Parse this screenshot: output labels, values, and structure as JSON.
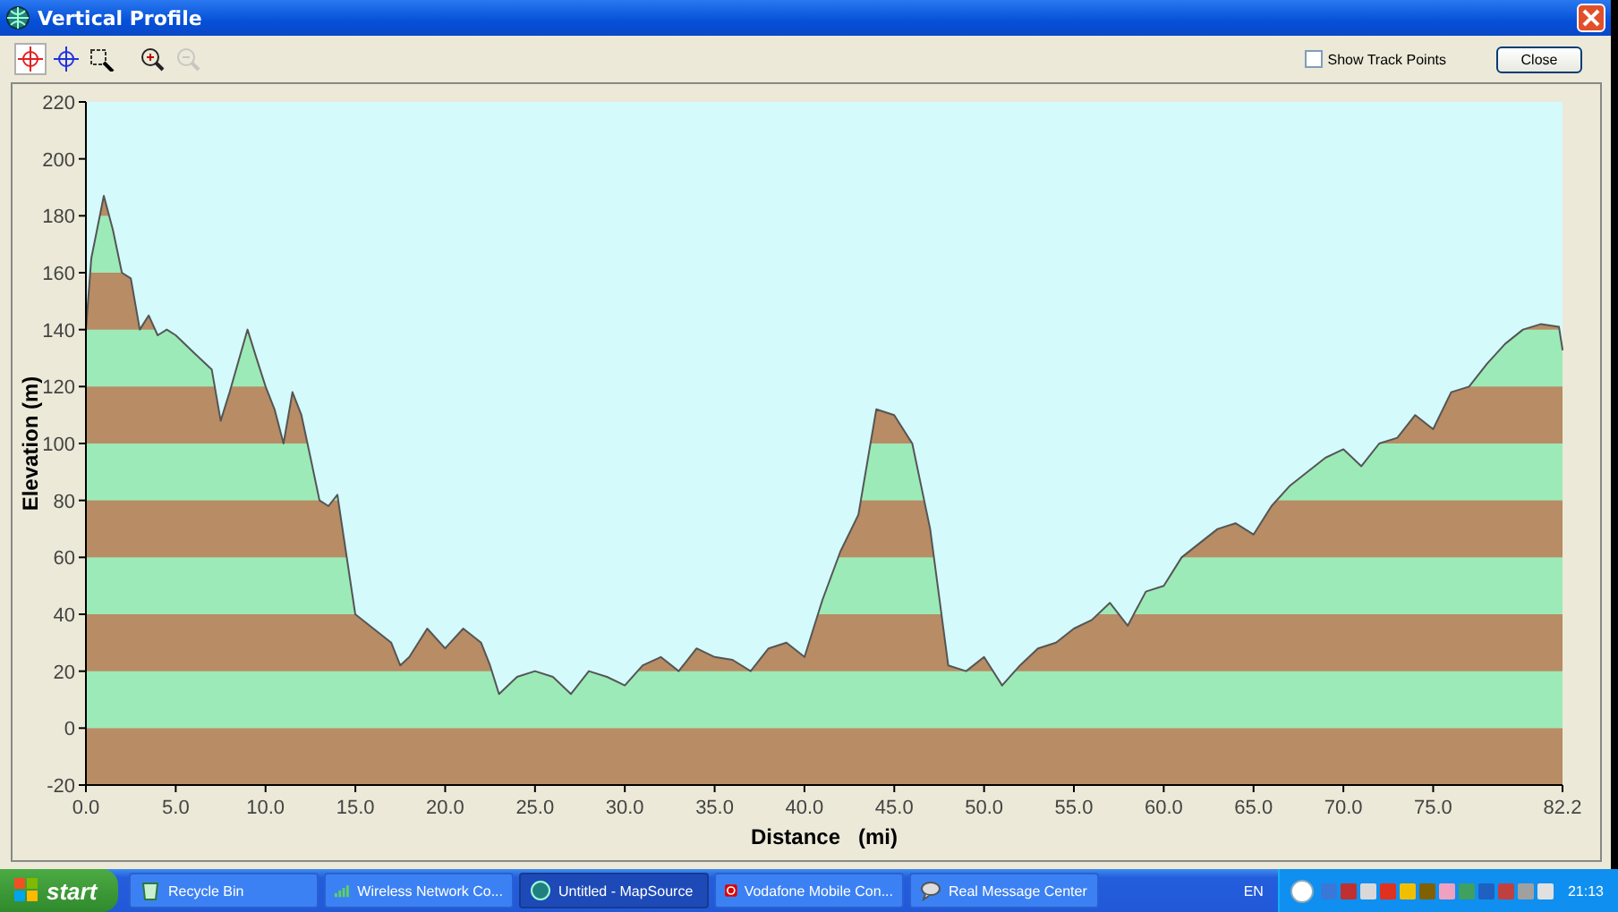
{
  "window": {
    "title": "Vertical Profile"
  },
  "toolbar": {
    "tools": [
      {
        "kind": "red-crosshair",
        "selected": true,
        "disabled": false
      },
      {
        "kind": "blue-crosshair",
        "selected": false,
        "disabled": false
      },
      {
        "kind": "zoom-box",
        "selected": false,
        "disabled": false
      },
      {
        "kind": "zoom-in",
        "selected": false,
        "disabled": false
      },
      {
        "kind": "zoom-out",
        "selected": false,
        "disabled": true
      }
    ],
    "show_track_points": {
      "label": "Show Track Points",
      "checked": false
    },
    "close_button": "Close"
  },
  "chart_data": {
    "type": "area",
    "xlabel": "Distance   (mi)",
    "ylabel": "Elevation (m)",
    "x": [
      0,
      0.3,
      1,
      1.5,
      2,
      2.5,
      3,
      3.5,
      4,
      4.5,
      5,
      6,
      7,
      7.5,
      8,
      9,
      9.5,
      10,
      10.5,
      11,
      11.5,
      12,
      12.5,
      13,
      13.5,
      14,
      15,
      16,
      17,
      17.5,
      18,
      19,
      20,
      21,
      22,
      22.5,
      23,
      24,
      25,
      26,
      27,
      28,
      29,
      30,
      31,
      32,
      33,
      34,
      35,
      36,
      37,
      38,
      39,
      40,
      41,
      42,
      43,
      44,
      45,
      46,
      47,
      48,
      49,
      50,
      51,
      52,
      53,
      54,
      55,
      56,
      57,
      58,
      59,
      60,
      61,
      62,
      63,
      64,
      65,
      66,
      67,
      68,
      69,
      70,
      71,
      72,
      73,
      74,
      75,
      76,
      77,
      78,
      79,
      80,
      81,
      82,
      82.2
    ],
    "series": [
      {
        "color": "#555555",
        "values": [
          140,
          165,
          187,
          175,
          160,
          158,
          140,
          145,
          138,
          140,
          138,
          132,
          126,
          108,
          118,
          140,
          130,
          120,
          112,
          100,
          118,
          110,
          95,
          80,
          78,
          82,
          40,
          35,
          30,
          22,
          25,
          35,
          28,
          35,
          30,
          22,
          12,
          18,
          20,
          18,
          12,
          20,
          18,
          15,
          22,
          25,
          20,
          28,
          25,
          24,
          20,
          28,
          30,
          25,
          45,
          62,
          75,
          112,
          110,
          100,
          70,
          22,
          20,
          25,
          15,
          22,
          28,
          30,
          35,
          38,
          44,
          36,
          48,
          50,
          60,
          65,
          70,
          72,
          68,
          78,
          85,
          90,
          95,
          98,
          92,
          100,
          102,
          110,
          105,
          118,
          120,
          128,
          135,
          140,
          142,
          141,
          133
        ]
      }
    ],
    "bands": [
      {
        "axis": "y",
        "from": -20,
        "to": 0,
        "color": "#b88c64"
      }
    ],
    "xlim": [
      0,
      82.2
    ],
    "ylim": [
      -20,
      220
    ],
    "xticks": [
      {
        "value": 0,
        "label": "0.0"
      },
      {
        "value": 5,
        "label": "5.0"
      },
      {
        "value": 10,
        "label": "10.0"
      },
      {
        "value": 15,
        "label": "15.0"
      },
      {
        "value": 20,
        "label": "20.0"
      },
      {
        "value": 25,
        "label": "25.0"
      },
      {
        "value": 30,
        "label": "30.0"
      },
      {
        "value": 35,
        "label": "35.0"
      },
      {
        "value": 40,
        "label": "40.0"
      },
      {
        "value": 45,
        "label": "45.0"
      },
      {
        "value": 50,
        "label": "50.0"
      },
      {
        "value": 55,
        "label": "55.0"
      },
      {
        "value": 60,
        "label": "60.0"
      },
      {
        "value": 65,
        "label": "65.0"
      },
      {
        "value": 70,
        "label": "70.0"
      },
      {
        "value": 75,
        "label": "75.0"
      },
      {
        "value": 82.2,
        "label": "82.2"
      }
    ],
    "yticks": [
      -20,
      0,
      20,
      40,
      60,
      80,
      100,
      120,
      140,
      160,
      180,
      200,
      220
    ]
  },
  "taskbar": {
    "start": "start",
    "tasks": [
      {
        "label": "Recycle Bin",
        "kind": "bin",
        "selected": false
      },
      {
        "label": "Wireless Network Co...",
        "kind": "wireless",
        "selected": false
      },
      {
        "label": "Untitled - MapSource",
        "kind": "mapsource",
        "selected": true
      },
      {
        "label": "Vodafone Mobile Con...",
        "kind": "vodafone",
        "selected": false
      },
      {
        "label": "Real Message Center",
        "kind": "real",
        "selected": false
      }
    ],
    "language": "EN",
    "clock": "21:13"
  }
}
